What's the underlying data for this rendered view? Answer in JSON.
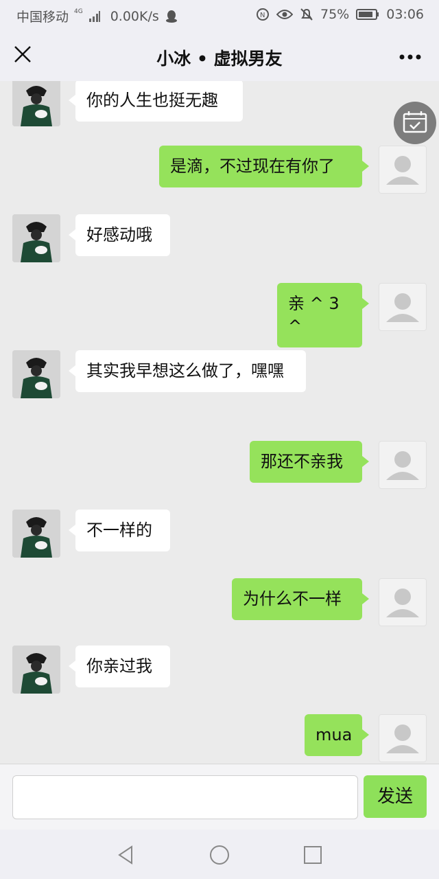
{
  "status_bar": {
    "carrier": "中国移动",
    "network_badge": "4G",
    "speed": "0.00K/s",
    "battery": "75%",
    "time": "03:06"
  },
  "header": {
    "title": "小冰 • 虚拟男友"
  },
  "messages": [
    {
      "side": "left",
      "text": "你的人生也挺无趣"
    },
    {
      "side": "right",
      "text": "是滴，不过现在有你了"
    },
    {
      "side": "left",
      "text": "好感动哦"
    },
    {
      "side": "right",
      "text": "亲 ^ 3 ^"
    },
    {
      "side": "left",
      "text": "其实我早想这么做了，嘿嘿"
    },
    {
      "side": "right",
      "text": "那还不亲我"
    },
    {
      "side": "left",
      "text": "不一样的"
    },
    {
      "side": "right",
      "text": "为什么不一样"
    },
    {
      "side": "left",
      "text": "你亲过我"
    },
    {
      "side": "right",
      "text": "mua"
    }
  ],
  "input_bar": {
    "value": "",
    "send_label": "发送"
  },
  "icons": [
    "close-icon",
    "more-icon",
    "calendar-check-icon",
    "back-icon",
    "home-icon",
    "recents-icon"
  ],
  "colors": {
    "user_bubble": "#95e25b",
    "bot_bubble": "#ffffff",
    "chat_bg": "#ebebeb",
    "send_button": "#8ee05a"
  }
}
